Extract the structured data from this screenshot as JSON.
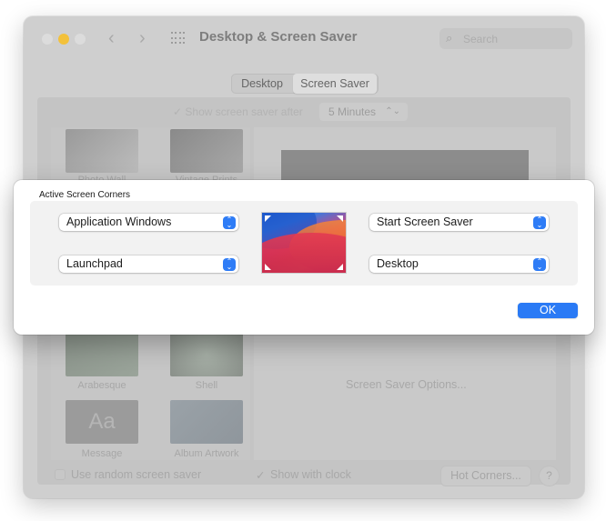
{
  "window": {
    "title": "Desktop & Screen Saver",
    "search_placeholder": "Search",
    "tabs": [
      {
        "label": "Desktop",
        "active": false
      },
      {
        "label": "Screen Saver",
        "active": true
      }
    ]
  },
  "screen_saver": {
    "show_after_label": "Show screen saver after",
    "show_after_value": "5 Minutes",
    "savers": [
      {
        "label": "Photo Wall"
      },
      {
        "label": "Vintage Prints"
      },
      {
        "label": "Arabesque"
      },
      {
        "label": "Shell"
      },
      {
        "label": "Message"
      },
      {
        "label": "Album Artwork"
      }
    ],
    "message_thumb_text": "Aa",
    "options_button": "Screen Saver Options...",
    "random_label": "Use random screen saver",
    "show_clock_label": "Show with clock",
    "show_clock_checked": true,
    "hot_corners_button": "Hot Corners...",
    "help_button": "?"
  },
  "dialog": {
    "title": "Active Screen Corners",
    "top_left": "Application Windows",
    "top_right": "Start Screen Saver",
    "bottom_left": "Launchpad",
    "bottom_right": "Desktop",
    "ok_button": "OK"
  },
  "colors": {
    "accent": "#2a7af5",
    "close": "#dadada",
    "minimize": "#f5c33a",
    "zoom": "#dadada"
  }
}
